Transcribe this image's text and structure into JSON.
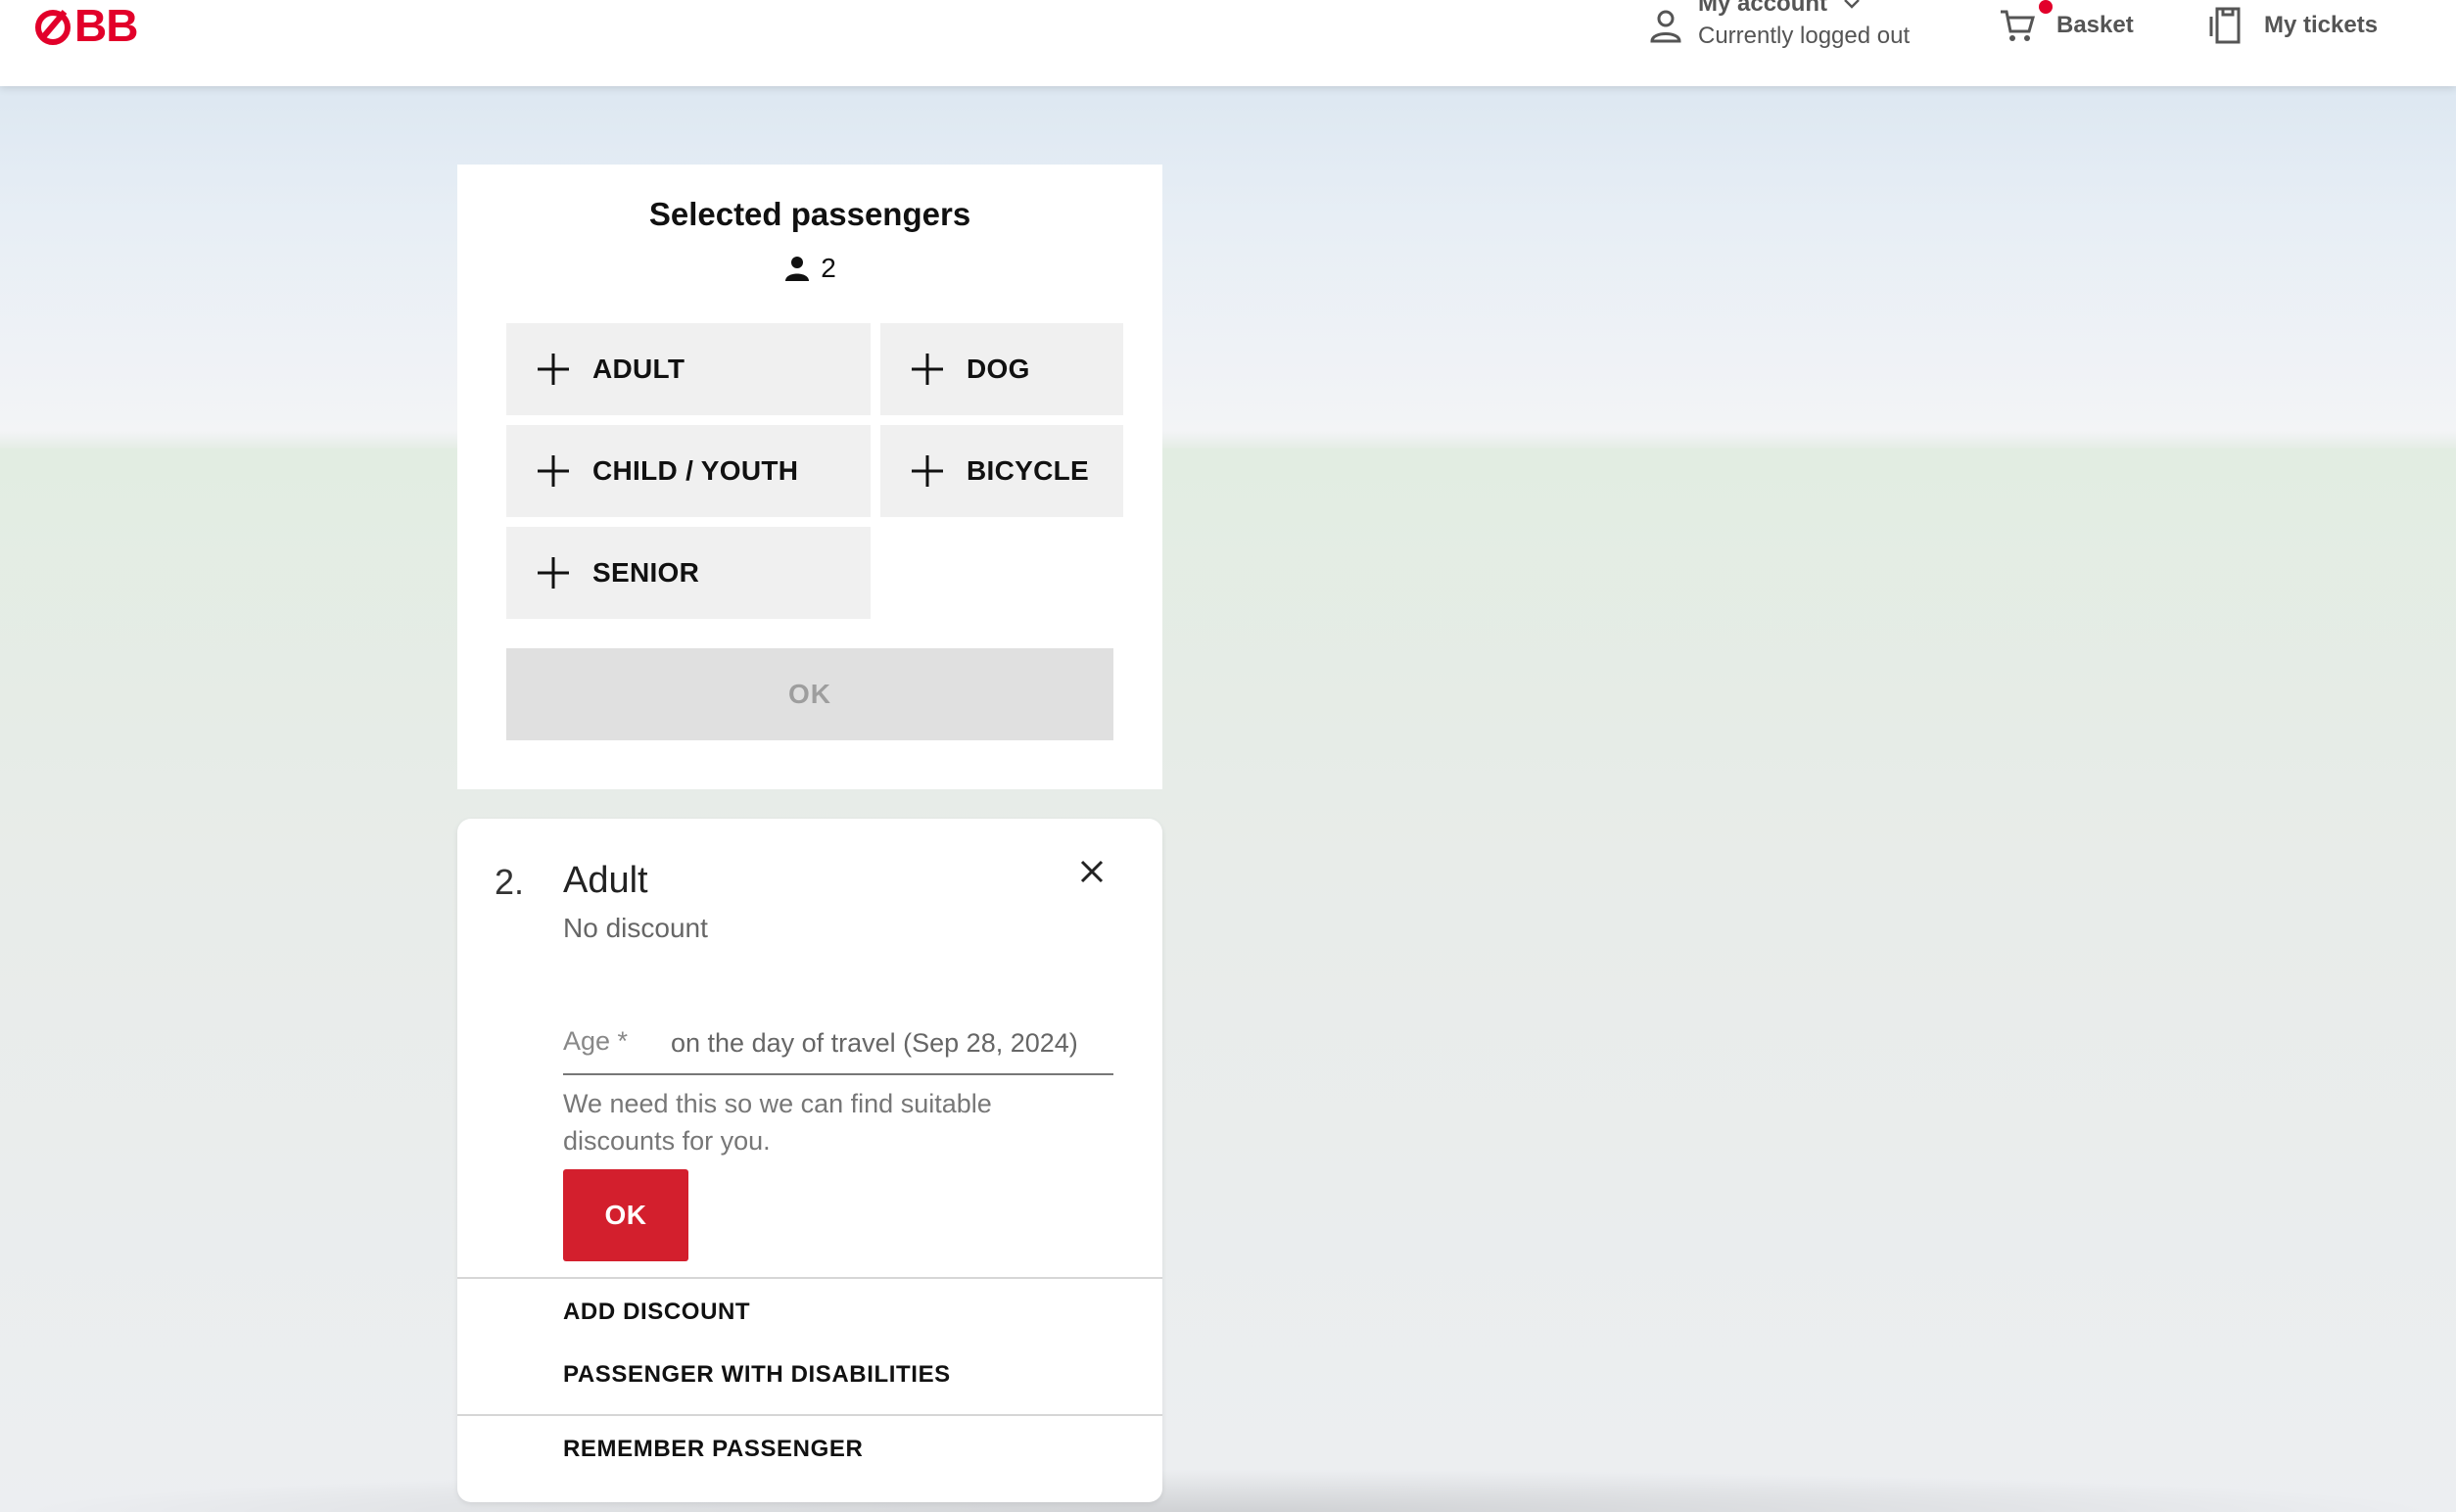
{
  "header": {
    "logo_text": "ÖBB",
    "logo_text_rest": "BB",
    "account_title": "My account",
    "account_status": "Currently logged out",
    "basket_label": "Basket",
    "tickets_label": "My tickets"
  },
  "selection": {
    "title": "Selected passengers",
    "count": "2",
    "types": [
      {
        "label": "ADULT"
      },
      {
        "label": "DOG"
      },
      {
        "label": "CHILD / YOUTH"
      },
      {
        "label": "BICYCLE"
      },
      {
        "label": "SENIOR"
      }
    ],
    "ok_label": "OK"
  },
  "passenger": {
    "number": "2.",
    "name": "Adult",
    "discount": "No discount",
    "age_label": "Age *",
    "age_value": "",
    "age_hint": "on the day of travel (Sep 28, 2024)",
    "helper_text": "We need this so we can find suitable discounts for you.",
    "ok_label": "OK",
    "add_discount": "ADD DISCOUNT",
    "disabilities": "PASSENGER WITH DISABILITIES",
    "remember": "REMEMBER PASSENGER"
  },
  "colors": {
    "brand_red": "#e2002a",
    "ok_red": "#d31f2d",
    "disabled_bg": "#e0e0e0"
  },
  "icons": {
    "account": "person-outline-icon",
    "basket": "shopping-cart-icon",
    "tickets": "ticket-icon",
    "close": "close-icon",
    "add": "plus-icon"
  }
}
